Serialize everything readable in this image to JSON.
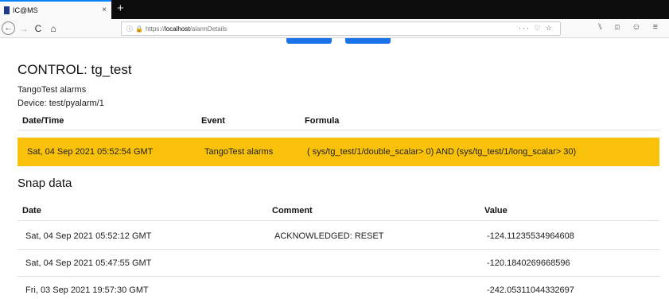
{
  "browser": {
    "tab_title": "IC@MS",
    "tab_close": "×",
    "new_tab": "+",
    "url_prefix": "https://",
    "url_host": "localhost",
    "url_path": "/alarmDetails",
    "back": "←",
    "forward": "→",
    "reload": "C",
    "home": "⌂",
    "url_actions": "··· ♡ ☆",
    "toolbar_icons": "⑊ ◫ ☺ ≡"
  },
  "page": {
    "title": "CONTROL: tg_test",
    "subtitle": "TangoTest alarms",
    "device": "Device: test/pyalarm/1"
  },
  "alarm_table": {
    "headers": {
      "date": "Date/Time",
      "event": "Event",
      "formula": "Formula"
    },
    "row": {
      "date": "Sat, 04 Sep 2021 05:52:54 GMT",
      "event": "TangoTest alarms",
      "formula": "( sys/tg_test/1/double_scalar> 0) AND (sys/tg_test/1/long_scalar> 30)"
    },
    "highlight_color": "#f9c10a"
  },
  "snap": {
    "title": "Snap data",
    "headers": {
      "date": "Date",
      "comment": "Comment",
      "value": "Value"
    },
    "rows": [
      {
        "date": "Sat, 04 Sep 2021 05:52:12 GMT",
        "comment": "ACKNOWLEDGED: RESET",
        "value": "-124.11235534964608"
      },
      {
        "date": "Sat, 04 Sep 2021 05:47:55 GMT",
        "comment": "",
        "value": "-120.1840269668596"
      },
      {
        "date": "Fri, 03 Sep 2021 19:57:30 GMT",
        "comment": "",
        "value": "-242.05311044332697"
      }
    ]
  },
  "colors": {
    "accent": "#1a73e8",
    "tab_border": "#0a84ff"
  }
}
